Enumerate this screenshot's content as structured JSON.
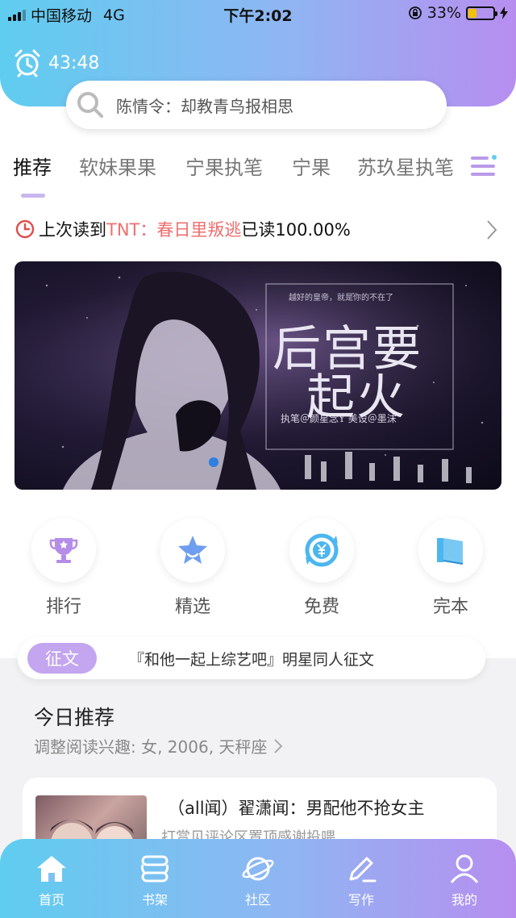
{
  "status_bar": {
    "carrier": "中国移动",
    "network": "4G",
    "time": "下午2:02",
    "battery_percent_text": "33%",
    "battery_level": 0.33
  },
  "header": {
    "timer": "43:48",
    "search_placeholder": "陈情令：却教青鸟报相思"
  },
  "tabs": [
    {
      "label": "推荐",
      "active": true
    },
    {
      "label": "软妹果果",
      "active": false
    },
    {
      "label": "宁果执笔",
      "active": false
    },
    {
      "label": "宁果",
      "active": false
    },
    {
      "label": "苏玖星执笔",
      "active": false
    }
  ],
  "last_read": {
    "prefix": "上次读到",
    "book": "TNT：春日里叛逃",
    "progress_text": "已读100.00%"
  },
  "banner": {
    "title_line1": "后宫要",
    "title_line2": "起火",
    "small_top": "越好的皇帝，就是你的不在了",
    "credit": "执笔＠颜星念Y   美设＠墨沫"
  },
  "categories": [
    {
      "label": "排行",
      "icon": "trophy-icon"
    },
    {
      "label": "精选",
      "icon": "star-icon"
    },
    {
      "label": "免费",
      "icon": "yen-refresh-icon"
    },
    {
      "label": "完本",
      "icon": "book-icon"
    }
  ],
  "contest": {
    "tag": "征文",
    "text": "『和他一起上综艺吧』明星同人征文"
  },
  "today": {
    "title": "今日推荐",
    "subtitle": "调整阅读兴趣: 女, 2006, 天秤座"
  },
  "recommend_card": {
    "title": "（all闻）翟潇闻：男配他不抢女主",
    "subtitle": "打赏见评论区置顶感谢投喂"
  },
  "bottom_nav": [
    {
      "label": "首页",
      "icon": "home-icon"
    },
    {
      "label": "书架",
      "icon": "bookshelf-icon"
    },
    {
      "label": "社区",
      "icon": "planet-icon"
    },
    {
      "label": "写作",
      "icon": "pen-icon"
    },
    {
      "label": "我的",
      "icon": "user-icon"
    }
  ],
  "colors": {
    "gradient_start": "#5fcdf0",
    "gradient_end": "#b78ef0",
    "accent_purple": "#c3a6ef",
    "book_red": "#ee6f6f"
  }
}
